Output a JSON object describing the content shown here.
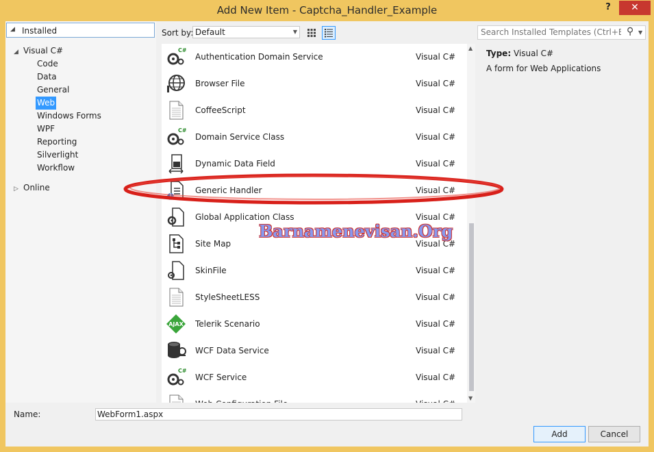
{
  "window": {
    "title": "Add New Item - Captcha_Handler_Example",
    "help_label": "?",
    "close_label": "✕"
  },
  "left_panel": {
    "installed": "Installed",
    "visual_csharp": "Visual C#",
    "children": [
      "Code",
      "Data",
      "General",
      "Web",
      "Windows Forms",
      "WPF",
      "Reporting",
      "Silverlight",
      "Workflow"
    ],
    "selected": "Web",
    "online": "Online"
  },
  "sortbar": {
    "label": "Sort by:",
    "value": "Default"
  },
  "items": [
    {
      "name": "Authentication Domain Service",
      "lang": "Visual C#",
      "icon": "gear-cs-icon"
    },
    {
      "name": "Browser File",
      "lang": "Visual C#",
      "icon": "globe-icon"
    },
    {
      "name": "CoffeeScript",
      "lang": "Visual C#",
      "icon": "document-icon"
    },
    {
      "name": "Domain Service Class",
      "lang": "Visual C#",
      "icon": "gear-cs-icon"
    },
    {
      "name": "Dynamic Data Field",
      "lang": "Visual C#",
      "icon": "data-field-icon"
    },
    {
      "name": "Generic Handler",
      "lang": "Visual C#",
      "icon": "handler-icon"
    },
    {
      "name": "Global Application Class",
      "lang": "Visual C#",
      "icon": "gear-document-icon"
    },
    {
      "name": "Site Map",
      "lang": "Visual C#",
      "icon": "sitemap-icon"
    },
    {
      "name": "SkinFile",
      "lang": "Visual C#",
      "icon": "skin-file-icon"
    },
    {
      "name": "StyleSheetLESS",
      "lang": "Visual C#",
      "icon": "document-icon"
    },
    {
      "name": "Telerik Scenario",
      "lang": "Visual C#",
      "icon": "ajax-icon"
    },
    {
      "name": "WCF Data Service",
      "lang": "Visual C#",
      "icon": "database-icon"
    },
    {
      "name": "WCF Service",
      "lang": "Visual C#",
      "icon": "gear-cs-icon"
    },
    {
      "name": "Web Configuration File",
      "lang": "Visual C#",
      "icon": "document-icon"
    }
  ],
  "watermark": "Barnamenevisan.Org",
  "search": {
    "placeholder": "Search Installed Templates (Ctrl+E)"
  },
  "info": {
    "type_key": "Type:",
    "type_value": "Visual C#",
    "description": "A form for Web Applications"
  },
  "bottom": {
    "name_label": "Name:",
    "name_value": "WebForm1.aspx",
    "add_label": "Add",
    "cancel_label": "Cancel"
  },
  "colors": {
    "frame": "#f0c660",
    "close": "#c7372f",
    "selection": "#3399ff",
    "highlight_oval": "#d8201a"
  }
}
